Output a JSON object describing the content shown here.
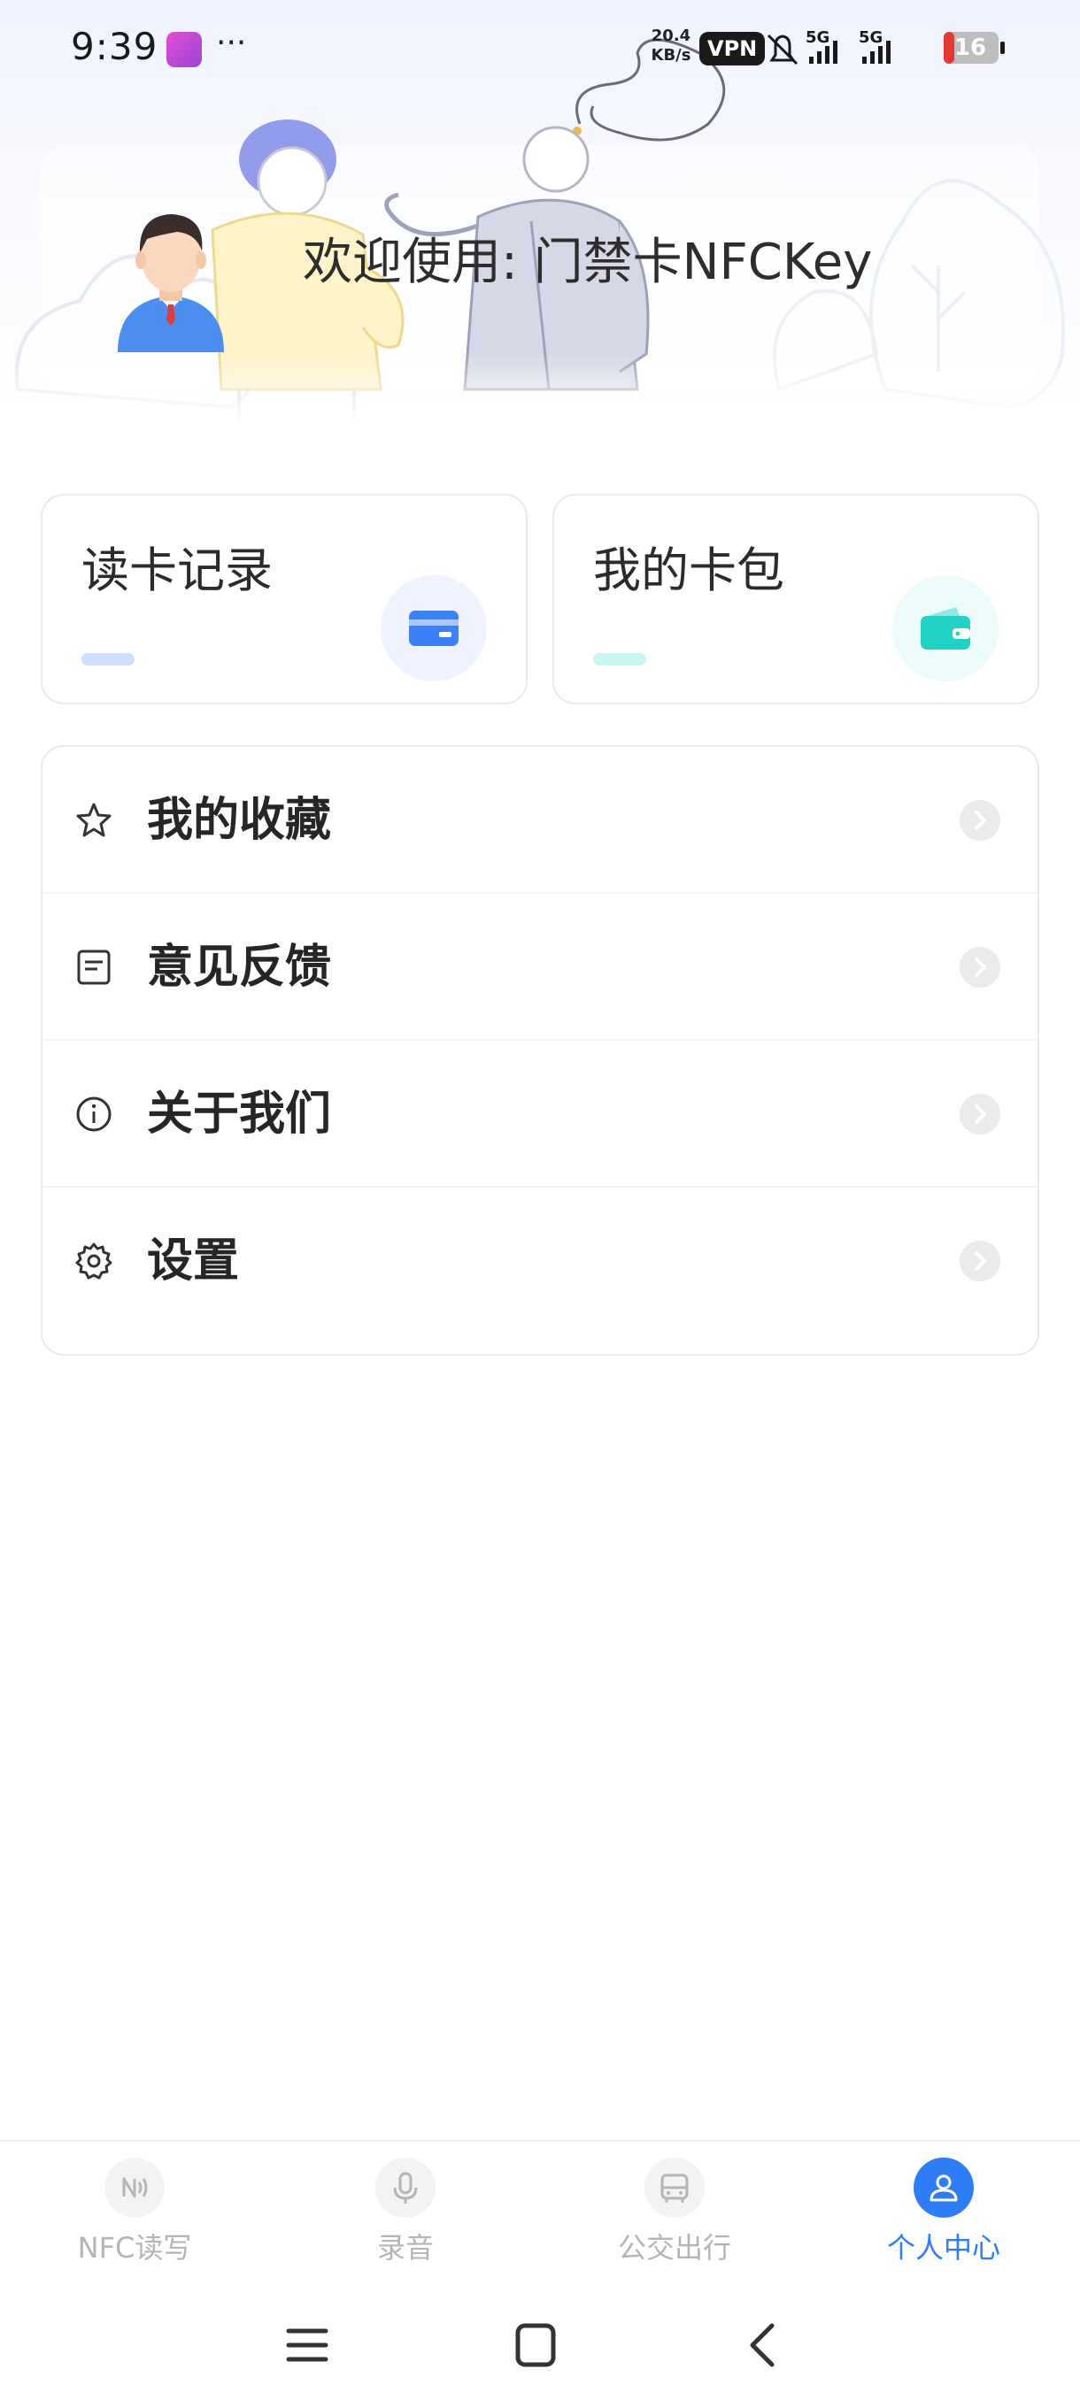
{
  "status_bar": {
    "time": "9:39",
    "more": "···",
    "speed_value": "20.4",
    "speed_unit": "KB/s",
    "vpn": "VPN",
    "battery": "16",
    "icons": [
      "app-notification-icon",
      "mute-bell-icon",
      "signal-5g-icon",
      "signal-5g-icon",
      "battery-icon"
    ]
  },
  "header": {
    "welcome": "欢迎使用: 门禁卡NFCKey",
    "avatar": "avatar-icon"
  },
  "quick_cards": [
    {
      "title": "读卡记录",
      "icon": "card-icon",
      "accent": "#3b82f6",
      "bar_color": "#cfe0ff",
      "icon_bg": "#eef3ff"
    },
    {
      "title": "我的卡包",
      "icon": "wallet-icon",
      "accent": "#22d3c5",
      "bar_color": "#c9f6f1",
      "icon_bg": "#eafbf9"
    }
  ],
  "menu": [
    {
      "label": "我的收藏",
      "icon": "star-icon"
    },
    {
      "label": "意见反馈",
      "icon": "feedback-icon"
    },
    {
      "label": "关于我们",
      "icon": "info-icon"
    },
    {
      "label": "设置",
      "icon": "gear-icon"
    }
  ],
  "bottom_nav": {
    "active_index": 3,
    "active_color": "#2f7df6",
    "items": [
      {
        "label": "NFC读写",
        "icon": "nfc-icon"
      },
      {
        "label": "录音",
        "icon": "microphone-icon"
      },
      {
        "label": "公交出行",
        "icon": "bus-icon"
      },
      {
        "label": "个人中心",
        "icon": "person-icon"
      }
    ]
  },
  "system_nav": [
    "menu-icon",
    "home-icon",
    "back-icon"
  ]
}
